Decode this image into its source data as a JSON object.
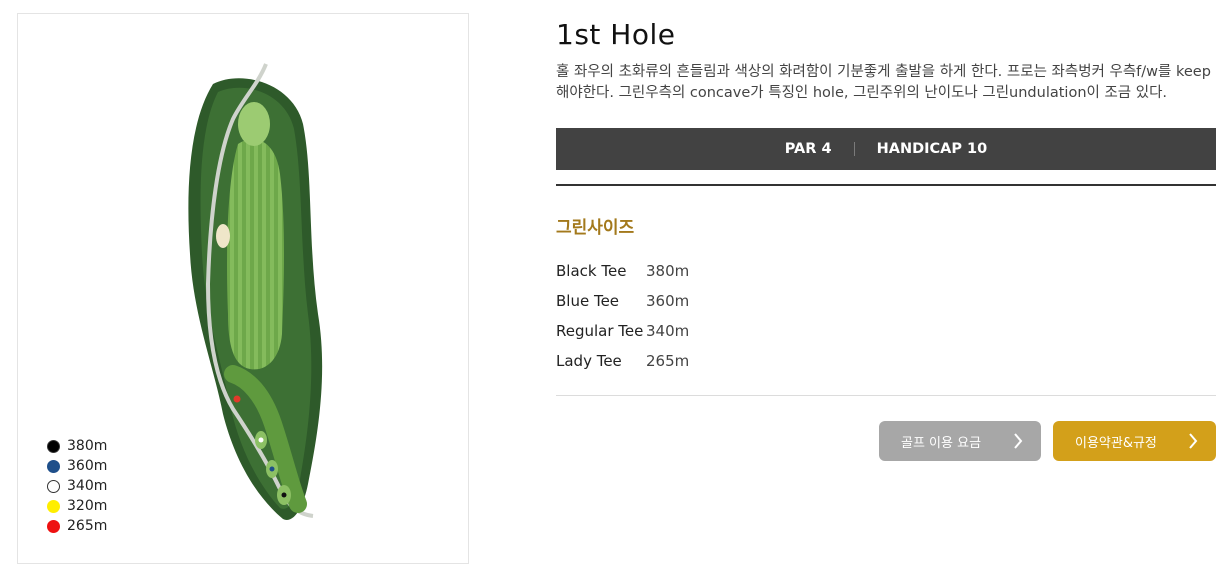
{
  "hole": {
    "title": "1st Hole",
    "description": "홀 좌우의 초화류의 흔들림과 색상의 화려함이 기분좋게 출발을 하게 한다. 프로는 좌측벙커 우측f/w를 keep 해야한다. 그린우측의 concave가 특징인 hole, 그린주위의 난이도나 그린undulation이 조금 있다."
  },
  "info": {
    "par": "PAR 4",
    "handicap": "HANDICAP 10"
  },
  "green_section": {
    "title": "그린사이즈"
  },
  "tees": [
    {
      "name": "Black Tee",
      "distance": "380m"
    },
    {
      "name": "Blue Tee",
      "distance": "360m"
    },
    {
      "name": "Regular Tee",
      "distance": "340m"
    },
    {
      "name": "Lady Tee",
      "distance": "265m"
    }
  ],
  "legend": [
    {
      "label": "380m",
      "color": "#000000"
    },
    {
      "label": "360m",
      "color": "#1f4f8a"
    },
    {
      "label": "340m",
      "color": "#ffffff"
    },
    {
      "label": "320m",
      "color": "#ffee00"
    },
    {
      "label": "265m",
      "color": "#ee1111"
    }
  ],
  "buttons": {
    "fee": "골프 이용 요금",
    "terms": "이용약관&규정"
  },
  "colors": {
    "accent_gold": "#d3a01a",
    "section_title": "#a3791c",
    "bar_dark": "#424242",
    "button_gray": "#a7a7a7"
  }
}
